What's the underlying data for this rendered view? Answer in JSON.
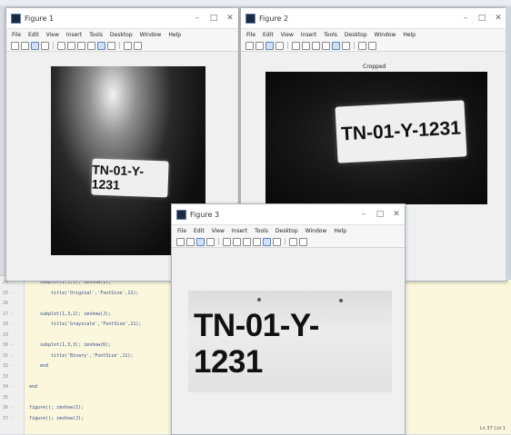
{
  "figures": [
    {
      "window_title": "Figure 1",
      "menu": [
        "File",
        "Edit",
        "View",
        "Insert",
        "Tools",
        "Desktop",
        "Window",
        "Help"
      ],
      "plate_text": "TN-01-Y-1231",
      "axes_title": ""
    },
    {
      "window_title": "Figure 2",
      "menu": [
        "File",
        "Edit",
        "View",
        "Insert",
        "Tools",
        "Desktop",
        "Window",
        "Help"
      ],
      "plate_text": "TN-01-Y-1231",
      "axes_title": "Cropped"
    },
    {
      "window_title": "Figure 3",
      "menu": [
        "File",
        "Edit",
        "View",
        "Insert",
        "Tools",
        "Desktop",
        "Window",
        "Help"
      ],
      "plate_text": "TN-01-Y-1231",
      "axes_title": ""
    }
  ],
  "window_controls": {
    "minimize": "–",
    "maximize": "□",
    "close": "✕"
  },
  "editor": {
    "lines": [
      {
        "num": "24 -",
        "code": "    subplot(1,3,1); imshow(I);"
      },
      {
        "num": "25 -",
        "code": "        title('Original','FontSize',11);"
      },
      {
        "num": "26",
        "code": ""
      },
      {
        "num": "27 -",
        "code": "    subplot(1,3,2); imshow(J);"
      },
      {
        "num": "28 -",
        "code": "        title('Grayscale','FontSize',11);"
      },
      {
        "num": "29",
        "code": ""
      },
      {
        "num": "30 -",
        "code": "    subplot(1,3,3); imshow(K);"
      },
      {
        "num": "31 -",
        "code": "        title('Binary','FontSize',11);"
      },
      {
        "num": "32 -",
        "code": "    end"
      },
      {
        "num": "33",
        "code": ""
      },
      {
        "num": "34 -",
        "code": "end"
      },
      {
        "num": "35",
        "code": ""
      },
      {
        "num": "36 -",
        "code": "figure(); imshow(I);"
      },
      {
        "num": "37 -",
        "code": "figure(); imshow(J);"
      }
    ],
    "status": "Ln 37  Col 1"
  }
}
